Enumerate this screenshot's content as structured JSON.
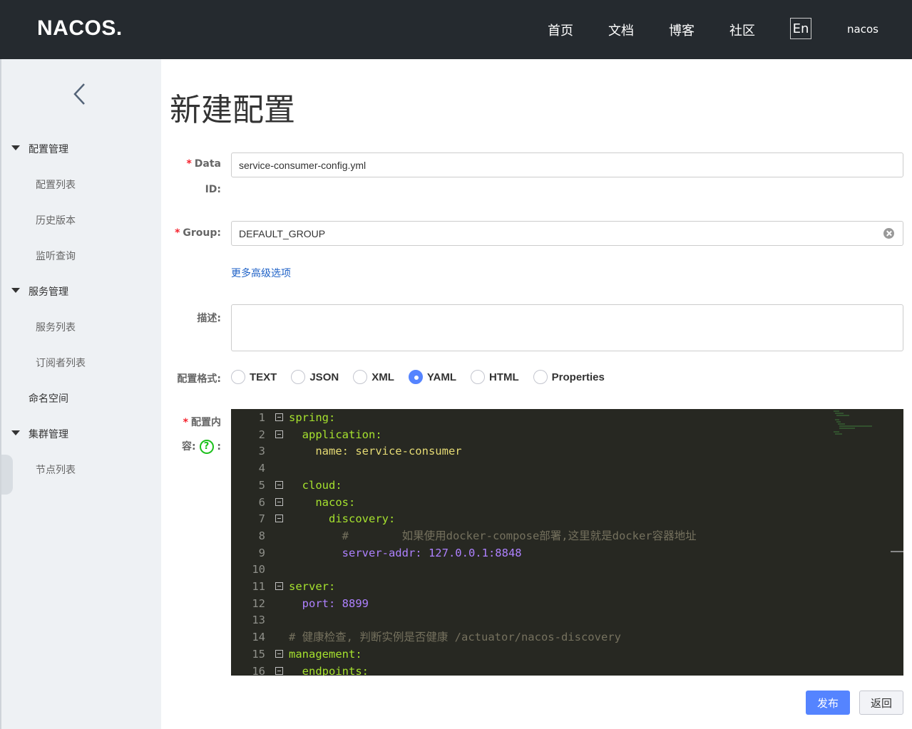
{
  "header": {
    "logo": "NACOS.",
    "nav": [
      "首页",
      "文档",
      "博客",
      "社区"
    ],
    "lang": "En",
    "user": "nacos"
  },
  "sidebar": {
    "groups": [
      {
        "label": "配置管理",
        "items": [
          "配置列表",
          "历史版本",
          "监听查询"
        ]
      },
      {
        "label": "服务管理",
        "items": [
          "服务列表",
          "订阅者列表"
        ]
      },
      {
        "label": "命名空间",
        "items": []
      },
      {
        "label": "集群管理",
        "items": [
          "节点列表"
        ]
      }
    ]
  },
  "page": {
    "title": "新建配置"
  },
  "form": {
    "data_id_label_1": "Data",
    "data_id_label_2": "ID:",
    "data_id_value": "service-consumer-config.yml",
    "group_label": "Group:",
    "group_value": "DEFAULT_GROUP",
    "advanced_link": "更多高级选项",
    "desc_label": "描述:",
    "format_label": "配置格式:",
    "formats": [
      "TEXT",
      "JSON",
      "XML",
      "YAML",
      "HTML",
      "Properties"
    ],
    "selected_format": "YAML",
    "content_label_1": "配置内",
    "content_label_2": "容:",
    "content_label_colon": ":",
    "required_mark": "*"
  },
  "editor": {
    "lines": [
      {
        "n": "1",
        "text": "spring:"
      },
      {
        "n": "2",
        "text": "  application:"
      },
      {
        "n": "3",
        "text": "    name: service-consumer"
      },
      {
        "n": "4",
        "text": ""
      },
      {
        "n": "5",
        "text": "  cloud:"
      },
      {
        "n": "6",
        "text": "    nacos:"
      },
      {
        "n": "7",
        "text": "      discovery:"
      },
      {
        "n": "8",
        "text": "        #        如果使用docker-compose部署,这里就是docker容器地址"
      },
      {
        "n": "9",
        "text": "        server-addr: 127.0.0.1:8848"
      },
      {
        "n": "10",
        "text": ""
      },
      {
        "n": "11",
        "text": "server:"
      },
      {
        "n": "12",
        "text": "  port: 8899"
      },
      {
        "n": "13",
        "text": ""
      },
      {
        "n": "14",
        "text": "# 健康检查, 判断实例是否健康 /actuator/nacos-discovery"
      },
      {
        "n": "15",
        "text": "management:"
      },
      {
        "n": "16",
        "text": "  endpoints:"
      }
    ]
  },
  "buttons": {
    "publish": "发布",
    "back": "返回"
  },
  "colors": {
    "header_bg": "#252a2f",
    "sidebar_bg": "#eef1f4",
    "primary": "#5584ff",
    "link": "#1f62c7",
    "required": "#f5222d",
    "editor_bg": "#272822"
  }
}
